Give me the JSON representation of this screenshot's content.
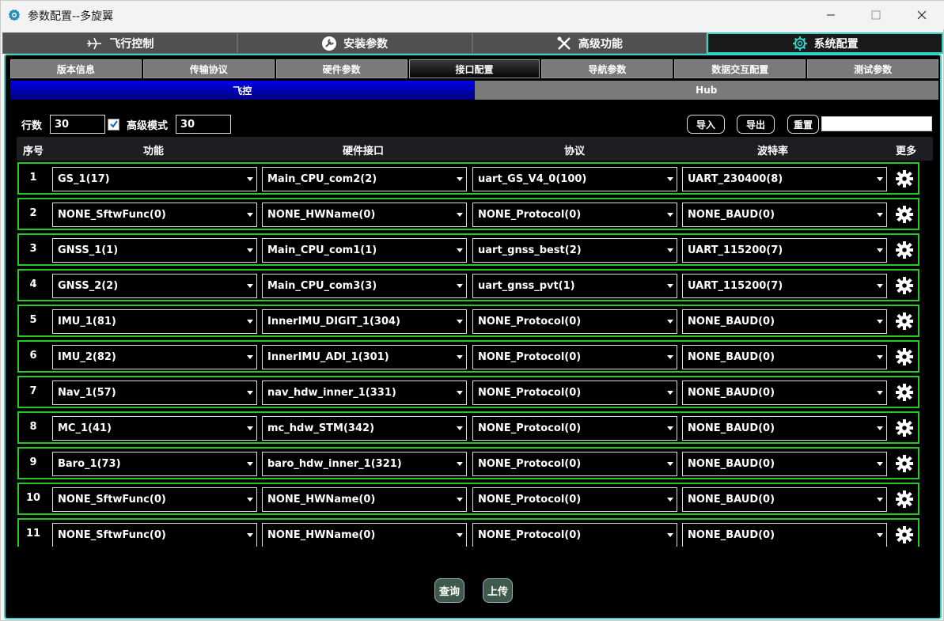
{
  "window": {
    "title": "参数配置--多旋翼",
    "app_icon": "gear-logo-icon"
  },
  "main_tabs": [
    {
      "label": "飞行控制",
      "icon": "airplane-icon"
    },
    {
      "label": "安装参数",
      "icon": "wrench-circle-icon"
    },
    {
      "label": "高级功能",
      "icon": "tools-icon"
    },
    {
      "label": "系统配置",
      "icon": "gear-icon",
      "active": true
    }
  ],
  "sub_tabs": [
    "版本信息",
    "传输协议",
    "硬件参数",
    "接口配置",
    "导航参数",
    "数据交互配置",
    "测试参数"
  ],
  "sub_tabs_active": "接口配置",
  "device_tabs": {
    "fk": "飞控",
    "hub": "Hub"
  },
  "toolbar": {
    "rows_label": "行数",
    "rows_value": "30",
    "advanced_label": "高级模式",
    "advanced_checked": true,
    "advanced_value": "30",
    "import_label": "导入",
    "export_label": "导出",
    "reset_label": "重置",
    "search_value": ""
  },
  "table": {
    "headers": {
      "index": "序号",
      "function": "功能",
      "hw": "硬件接口",
      "protocol": "协议",
      "baud": "波特率",
      "more": "更多"
    },
    "rows": [
      {
        "index": "1",
        "function": "GS_1(17)",
        "hw": "Main_CPU_com2(2)",
        "protocol": "uart_GS_V4_0(100)",
        "baud": "UART_230400(8)"
      },
      {
        "index": "2",
        "function": "NONE_SftwFunc(0)",
        "hw": "NONE_HWName(0)",
        "protocol": "NONE_Protocol(0)",
        "baud": "NONE_BAUD(0)"
      },
      {
        "index": "3",
        "function": "GNSS_1(1)",
        "hw": "Main_CPU_com1(1)",
        "protocol": "uart_gnss_best(2)",
        "baud": "UART_115200(7)"
      },
      {
        "index": "4",
        "function": "GNSS_2(2)",
        "hw": "Main_CPU_com3(3)",
        "protocol": "uart_gnss_pvt(1)",
        "baud": "UART_115200(7)"
      },
      {
        "index": "5",
        "function": "IMU_1(81)",
        "hw": "InnerIMU_DIGIT_1(304)",
        "protocol": "NONE_Protocol(0)",
        "baud": "NONE_BAUD(0)"
      },
      {
        "index": "6",
        "function": "IMU_2(82)",
        "hw": "InnerIMU_ADI_1(301)",
        "protocol": "NONE_Protocol(0)",
        "baud": "NONE_BAUD(0)"
      },
      {
        "index": "7",
        "function": "Nav_1(57)",
        "hw": "nav_hdw_inner_1(331)",
        "protocol": "NONE_Protocol(0)",
        "baud": "NONE_BAUD(0)"
      },
      {
        "index": "8",
        "function": "MC_1(41)",
        "hw": "mc_hdw_STM(342)",
        "protocol": "NONE_Protocol(0)",
        "baud": "NONE_BAUD(0)"
      },
      {
        "index": "9",
        "function": "Baro_1(73)",
        "hw": "baro_hdw_inner_1(321)",
        "protocol": "NONE_Protocol(0)",
        "baud": "NONE_BAUD(0)"
      },
      {
        "index": "10",
        "function": "NONE_SftwFunc(0)",
        "hw": "NONE_HWName(0)",
        "protocol": "NONE_Protocol(0)",
        "baud": "NONE_BAUD(0)"
      },
      {
        "index": "11",
        "function": "NONE_SftwFunc(0)",
        "hw": "NONE_HWName(0)",
        "protocol": "NONE_Protocol(0)",
        "baud": "NONE_BAUD(0)"
      }
    ]
  },
  "footer": {
    "query_label": "查询",
    "upload_label": "上传"
  },
  "colors": {
    "accent": "#35d2c8",
    "row_border": "#22cc22",
    "active_device_tab": "#0000e8",
    "button_bg": "#3d5a4b"
  }
}
